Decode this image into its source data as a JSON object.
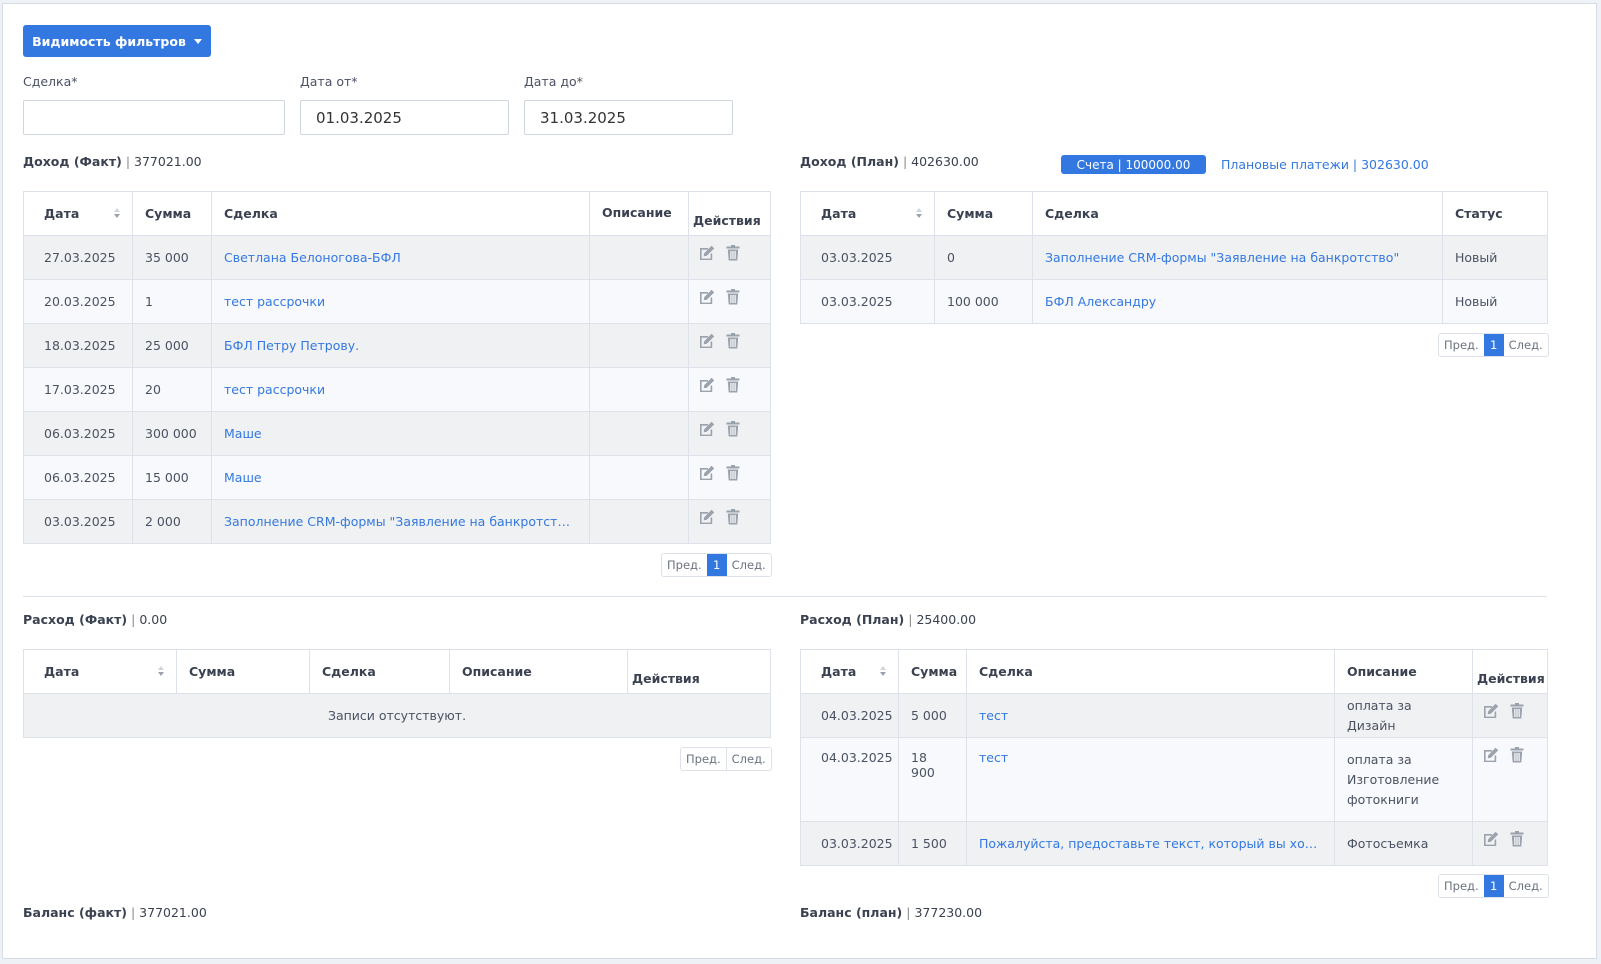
{
  "filters": {
    "toggle_label": "Видимость фильтров",
    "deal_label": "Сделка*",
    "deal_value": "",
    "date_from_label": "Дата от*",
    "date_from_value": "01.03.2025",
    "date_to_label": "Дата до*",
    "date_to_value": "31.03.2025"
  },
  "income_fact": {
    "title": "Доход (Факт)",
    "total": "377021.00",
    "columns": {
      "date": "Дата",
      "sum": "Сумма",
      "deal": "Сделка",
      "desc": "Описание",
      "actions": "Действия"
    },
    "rows": [
      {
        "date": "27.03.2025",
        "sum": "35 000",
        "deal": "Светлана Белоногова-БФЛ",
        "desc": ""
      },
      {
        "date": "20.03.2025",
        "sum": "1",
        "deal": "тест рассрочки",
        "desc": ""
      },
      {
        "date": "18.03.2025",
        "sum": "25 000",
        "deal": "БФЛ Петру Петрову.",
        "desc": ""
      },
      {
        "date": "17.03.2025",
        "sum": "20",
        "deal": "тест рассрочки",
        "desc": ""
      },
      {
        "date": "06.03.2025",
        "sum": "300 000",
        "deal": "Маше",
        "desc": ""
      },
      {
        "date": "06.03.2025",
        "sum": "15 000",
        "deal": "Маше",
        "desc": ""
      },
      {
        "date": "03.03.2025",
        "sum": "2 000",
        "deal": "Заполнение CRM-формы \"Заявление на банкротство\"",
        "desc": ""
      }
    ],
    "pager": {
      "prev": "Пред.",
      "page": "1",
      "next": "След."
    }
  },
  "income_plan": {
    "title": "Доход (План)",
    "total": "402630.00",
    "invoices_badge": "Счета | 100000.00",
    "planned_link": "Плановые платежи | 302630.00",
    "columns": {
      "date": "Дата",
      "sum": "Сумма",
      "deal": "Сделка",
      "status": "Статус"
    },
    "rows": [
      {
        "date": "03.03.2025",
        "sum": "0",
        "deal": "Заполнение CRM-формы \"Заявление на банкротство\"",
        "status": "Новый"
      },
      {
        "date": "03.03.2025",
        "sum": "100 000",
        "deal": "БФЛ Александру",
        "status": "Новый"
      }
    ],
    "pager": {
      "prev": "Пред.",
      "page": "1",
      "next": "След."
    }
  },
  "expense_fact": {
    "title": "Расход (Факт)",
    "total": "0.00",
    "columns": {
      "date": "Дата",
      "sum": "Сумма",
      "deal": "Сделка",
      "desc": "Описание",
      "actions": "Действия"
    },
    "empty": "Записи отсутствуют.",
    "pager": {
      "prev": "Пред.",
      "next": "След."
    }
  },
  "expense_plan": {
    "title": "Расход (План)",
    "total": "25400.00",
    "columns": {
      "date": "Дата",
      "sum": "Сумма",
      "deal": "Сделка",
      "desc": "Описание",
      "actions": "Действия"
    },
    "rows": [
      {
        "date": "04.03.2025",
        "sum": "5 000",
        "deal": "тест",
        "desc": "оплата за Дизайн"
      },
      {
        "date": "04.03.2025",
        "sum": "18 900",
        "deal": "тест",
        "desc": "оплата за Изготовление фотокниги"
      },
      {
        "date": "03.03.2025",
        "sum": "1 500",
        "deal": "Пожалуйста, предоставьте текст, который вы хотите перевести",
        "desc": "Фотосъемка"
      }
    ],
    "pager": {
      "prev": "Пред.",
      "page": "1",
      "next": "След."
    }
  },
  "balance_fact": {
    "title": "Баланс (факт)",
    "total": "377021.00"
  },
  "balance_plan": {
    "title": "Баланс (план)",
    "total": "377230.00"
  },
  "colors": {
    "accent": "#3378e0",
    "row_odd": "#f0f1f3",
    "row_even": "#f7f9fc"
  },
  "icons": {
    "edit": "edit-icon",
    "delete": "trash-icon"
  }
}
